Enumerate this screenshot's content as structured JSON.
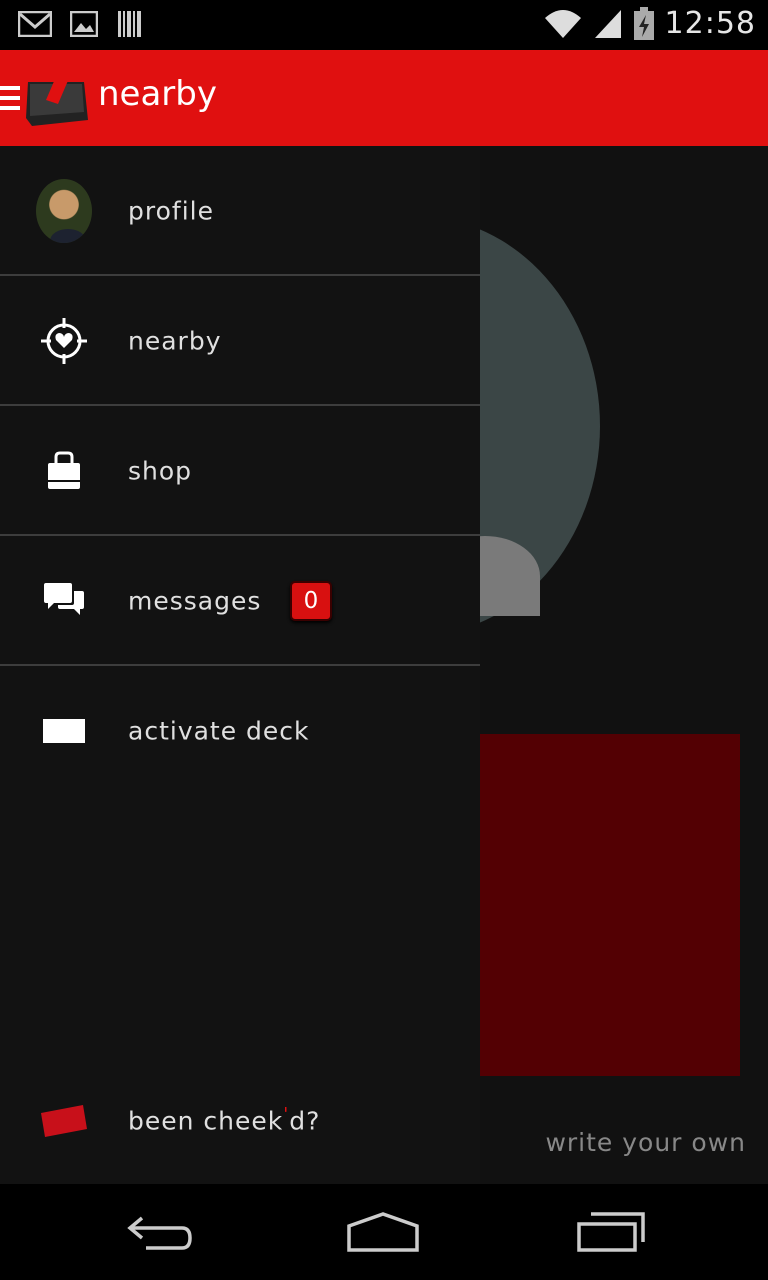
{
  "status_bar": {
    "time": "12:58",
    "icons": [
      "gmail-icon",
      "gallery-icon",
      "barcode-icon",
      "wifi-icon",
      "signal-icon",
      "battery-charging-icon"
    ]
  },
  "app_bar": {
    "title": "nearby"
  },
  "drawer": {
    "items": [
      {
        "name": "profile",
        "label": "profile",
        "icon": "avatar"
      },
      {
        "name": "nearby",
        "label": "nearby",
        "icon": "crosshair-heart-icon"
      },
      {
        "name": "shop",
        "label": "shop",
        "icon": "shopping-bag-icon"
      },
      {
        "name": "messages",
        "label": "messages",
        "icon": "chat-bubbles-icon",
        "badge": "0"
      },
      {
        "name": "activate-deck",
        "label": "activate deck",
        "icon": "card-icon"
      }
    ],
    "footer": {
      "label_prefix": "been cheek",
      "label_mark": "'",
      "label_suffix": "d?",
      "icon": "red-card-icon"
    }
  },
  "background": {
    "write_own": "write your own"
  },
  "nav_bar": {
    "buttons": [
      "back",
      "home",
      "recent-apps"
    ]
  },
  "colors": {
    "accent": "#e01010",
    "drawer_bg": "#121212",
    "divider": "#3d3d3d",
    "card_dark_red": "#530003"
  }
}
